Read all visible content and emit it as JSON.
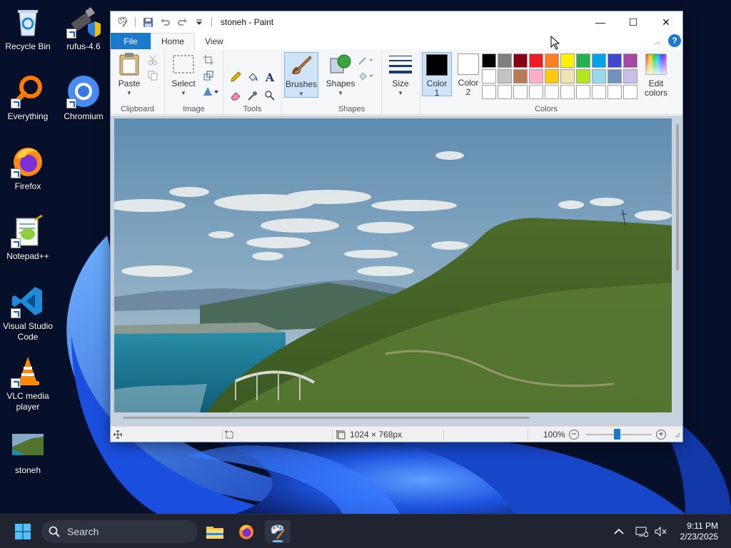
{
  "desktop": {
    "icons": [
      {
        "label": "Recycle Bin"
      },
      {
        "label": "rufus-4.6"
      },
      {
        "label": "Everything"
      },
      {
        "label": "Chromium"
      },
      {
        "label": "Firefox"
      },
      {
        "label": "Notepad++"
      },
      {
        "label": "Visual Studio Code"
      },
      {
        "label": "VLC media player"
      },
      {
        "label": "stoneh"
      }
    ]
  },
  "window": {
    "title": "stoneh - Paint",
    "controls": {
      "minimize": "—",
      "maximize": "☐",
      "close": "✕"
    }
  },
  "tabs": {
    "file": "File",
    "home": "Home",
    "view": "View",
    "help": "?"
  },
  "ribbon": {
    "clipboard": {
      "label": "Clipboard",
      "paste": "Paste"
    },
    "image": {
      "label": "Image",
      "select": "Select"
    },
    "tools": {
      "label": "Tools"
    },
    "brushes": {
      "label": "Brushes"
    },
    "shapes": {
      "label": "Shapes",
      "button": "Shapes"
    },
    "size": {
      "label": "Size"
    },
    "colors": {
      "label": "Colors",
      "color1": {
        "line1": "Color",
        "line2": "1",
        "value": "#000000"
      },
      "color2": {
        "line1": "Color",
        "line2": "2",
        "value": "#ffffff"
      },
      "edit": {
        "line1": "Edit",
        "line2": "colors"
      },
      "palette": [
        "#000000",
        "#7f7f7f",
        "#880015",
        "#ed1c24",
        "#ff7f27",
        "#fff200",
        "#22b14c",
        "#00a2e8",
        "#3f48cc",
        "#a349a4",
        "#ffffff",
        "#c3c3c3",
        "#b97a57",
        "#ffaec9",
        "#ffc90e",
        "#efe4b0",
        "#b5e61d",
        "#99d9ea",
        "#7092be",
        "#c8bfe7",
        "#ffffff",
        "#ffffff",
        "#ffffff",
        "#ffffff",
        "#ffffff",
        "#ffffff",
        "#ffffff",
        "#ffffff",
        "#ffffff",
        "#ffffff"
      ]
    }
  },
  "status": {
    "dimensions": "1024 × 768px",
    "zoom": "100%",
    "zoom_level": 1.0
  },
  "taskbar": {
    "search_placeholder": "Search",
    "time": "9:11 PM",
    "date": "2/23/2025"
  },
  "colors": {
    "accent": "#1979ca",
    "ribbon_bg": "#f5f6f7"
  }
}
